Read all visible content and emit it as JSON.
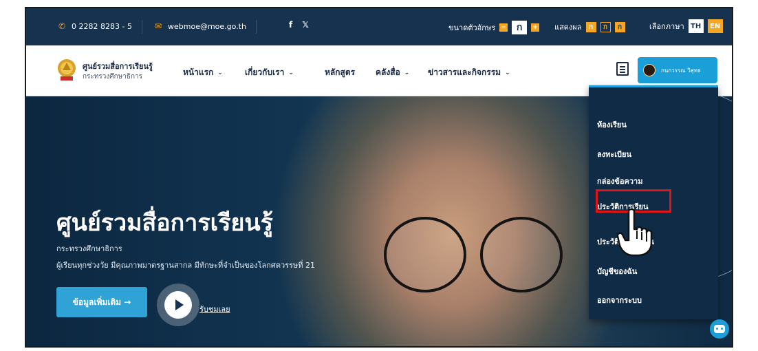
{
  "topbar": {
    "phone": "0 2282 8283 - 5",
    "email": "webmoe@moe.go.th",
    "social": [
      "f",
      "𝕏"
    ],
    "font_size_label": "ขนาดตัวอักษร",
    "font_size_options": [
      "−",
      "ก",
      "+"
    ],
    "display_label": "แสดงผล",
    "display_options": [
      "ก",
      "ก",
      "ก"
    ],
    "language_label": "เลือกภาษา",
    "languages": [
      "TH",
      "EN"
    ]
  },
  "navbar": {
    "logo_title": "ศูนย์รวมสื่อการเรียนรู้",
    "logo_subtitle": "กระทรวงศึกษาธิการ",
    "items": [
      {
        "label": "หน้าแรก",
        "has_dropdown": true
      },
      {
        "label": "เกี่ยวกับเรา",
        "has_dropdown": true
      },
      {
        "label": "หลักสูตร",
        "has_dropdown": false
      },
      {
        "label": "คลังสื่อ",
        "has_dropdown": true
      },
      {
        "label": "ข่าวสารและกิจกรรม",
        "has_dropdown": true
      }
    ],
    "user_name": "กนกวรรณ วิสุทธ"
  },
  "hero": {
    "title": "ศูนย์รวมสื่อการเรียนรู้",
    "subtitle": "กระทรวงศึกษาธิการ",
    "tagline": "ผู้เรียนทุกช่วงวัย มีคุณภาพมาตรฐานสากล มีทักษะที่จำเป็นของโลกศตวรรษที่ 21",
    "more_button": "ข้อมูลเพิ่มเติม →",
    "watch_link": "รับชมเลย"
  },
  "user_menu": {
    "items": [
      "ห้องเรียน",
      "ลงทะเบียน",
      "กล่องข้อความ",
      "ประวัติการเรียน",
      "ประวัติการใช้งาน",
      "บัญชีของฉัน",
      "ออกจากระบบ"
    ],
    "highlighted_item": "ประวัติการเรียน"
  },
  "colors": {
    "topbar": "#17324f",
    "accent": "#1a9fd9",
    "highlight": "#e01515",
    "font_orange": "#f5a623"
  }
}
